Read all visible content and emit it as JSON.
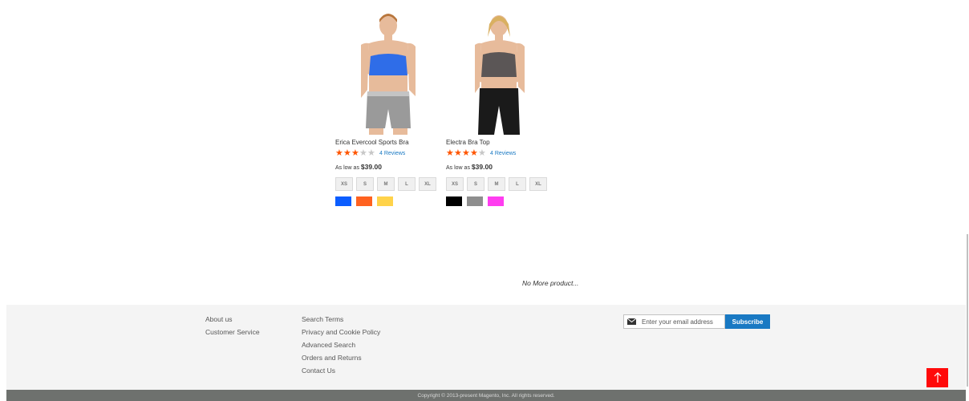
{
  "products": [
    {
      "name": "Erica Evercool Sports Bra",
      "rating_stars": 3,
      "reviews": "4  Reviews",
      "price_prefix": "As low as",
      "price": "$39.00",
      "sizes": [
        "XS",
        "S",
        "M",
        "L",
        "XL"
      ],
      "colors": [
        "#0b5dff",
        "#ff6220",
        "#ffd34a"
      ],
      "top_color": "#2f6de8",
      "bottom_color": "#9a9a9a"
    },
    {
      "name": "Electra Bra Top",
      "rating_stars": 4,
      "reviews": "4  Reviews",
      "price_prefix": "As low as",
      "price": "$39.00",
      "sizes": [
        "XS",
        "S",
        "M",
        "L",
        "XL"
      ],
      "colors": [
        "#000000",
        "#8e8e8e",
        "#ff3df0"
      ],
      "top_color": "#5b5656",
      "bottom_color": "#1a1a1a"
    }
  ],
  "no_more": "No More product...",
  "footer": {
    "col1": [
      "About us",
      "Customer Service"
    ],
    "col2": [
      "Search Terms",
      "Privacy and Cookie Policy",
      "Advanced Search",
      "Orders and Returns",
      "Contact Us"
    ],
    "newsletter_placeholder": "Enter your email address",
    "subscribe_label": "Subscribe",
    "copyright": "Copyright © 2013-present Magento, Inc. All rights reserved."
  },
  "icons": {
    "mail": "envelope-icon",
    "scroll_top": "arrow-up-icon"
  },
  "colors": {
    "accent": "#1979c3",
    "star": "#ff5501",
    "scroll_top": "#ff0a0a"
  }
}
